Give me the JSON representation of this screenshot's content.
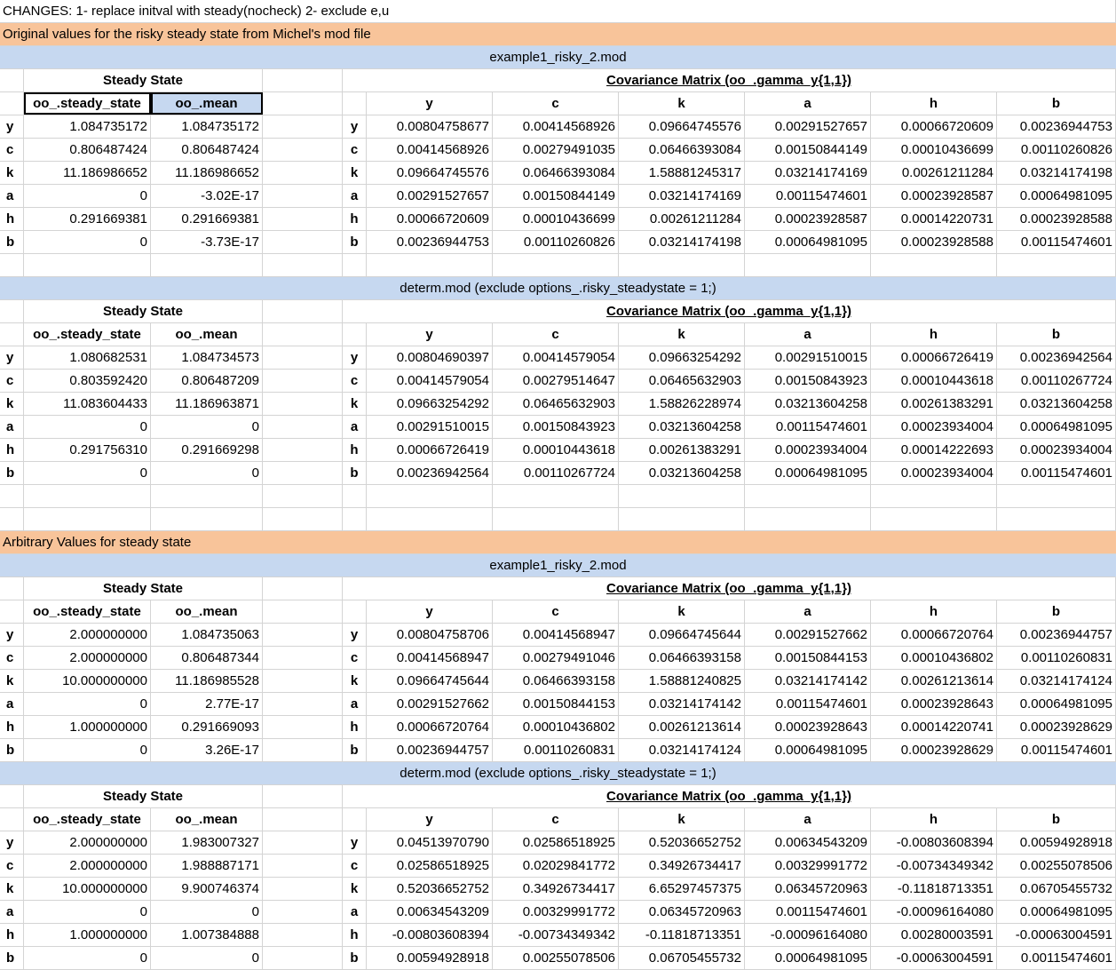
{
  "changes_note": "CHANGES: 1- replace initval with steady(nocheck) 2- exclude e,u",
  "vars": [
    "y",
    "c",
    "k",
    "a",
    "h",
    "b"
  ],
  "labels": {
    "steady_state": "Steady State",
    "cov_title": "Covariance Matrix (oo_.gamma_y{1,1})",
    "col_ss": "oo_.steady_state",
    "col_mean": "oo_.mean"
  },
  "sections": [
    {
      "title": "Original values for the risky steady state from Michel's mod file",
      "blocks": [
        {
          "title": "example1_risky_2.mod",
          "ss": [
            "1.084735172",
            "0.806487424",
            "11.186986652",
            "0",
            "0.291669381",
            "0"
          ],
          "mean": [
            "1.084735172",
            "0.806487424",
            "11.186986652",
            "-3.02E-17",
            "0.291669381",
            "-3.73E-17"
          ],
          "cov": [
            [
              "0.00804758677",
              "0.00414568926",
              "0.09664745576",
              "0.00291527657",
              "0.00066720609",
              "0.00236944753"
            ],
            [
              "0.00414568926",
              "0.00279491035",
              "0.06466393084",
              "0.00150844149",
              "0.00010436699",
              "0.00110260826"
            ],
            [
              "0.09664745576",
              "0.06466393084",
              "1.58881245317",
              "0.03214174169",
              "0.00261211284",
              "0.03214174198"
            ],
            [
              "0.00291527657",
              "0.00150844149",
              "0.03214174169",
              "0.00115474601",
              "0.00023928587",
              "0.00064981095"
            ],
            [
              "0.00066720609",
              "0.00010436699",
              "0.00261211284",
              "0.00023928587",
              "0.00014220731",
              "0.00023928588"
            ],
            [
              "0.00236944753",
              "0.00110260826",
              "0.03214174198",
              "0.00064981095",
              "0.00023928588",
              "0.00115474601"
            ]
          ]
        },
        {
          "title": "determ.mod (exclude options_.risky_steadystate = 1;)",
          "ss": [
            "1.080682531",
            "0.803592420",
            "11.083604433",
            "0",
            "0.291756310",
            "0"
          ],
          "mean": [
            "1.084734573",
            "0.806487209",
            "11.186963871",
            "0",
            "0.291669298",
            "0"
          ],
          "cov": [
            [
              "0.00804690397",
              "0.00414579054",
              "0.09663254292",
              "0.00291510015",
              "0.00066726419",
              "0.00236942564"
            ],
            [
              "0.00414579054",
              "0.00279514647",
              "0.06465632903",
              "0.00150843923",
              "0.00010443618",
              "0.00110267724"
            ],
            [
              "0.09663254292",
              "0.06465632903",
              "1.58826228974",
              "0.03213604258",
              "0.00261383291",
              "0.03213604258"
            ],
            [
              "0.00291510015",
              "0.00150843923",
              "0.03213604258",
              "0.00115474601",
              "0.00023934004",
              "0.00064981095"
            ],
            [
              "0.00066726419",
              "0.00010443618",
              "0.00261383291",
              "0.00023934004",
              "0.00014222693",
              "0.00023934004"
            ],
            [
              "0.00236942564",
              "0.00110267724",
              "0.03213604258",
              "0.00064981095",
              "0.00023934004",
              "0.00115474601"
            ]
          ]
        }
      ]
    },
    {
      "title": "Arbitrary Values for  steady state",
      "blocks": [
        {
          "title": "example1_risky_2.mod",
          "ss": [
            "2.000000000",
            "2.000000000",
            "10.000000000",
            "0",
            "1.000000000",
            "0"
          ],
          "mean": [
            "1.084735063",
            "0.806487344",
            "11.186985528",
            "2.77E-17",
            "0.291669093",
            "3.26E-17"
          ],
          "cov": [
            [
              "0.00804758706",
              "0.00414568947",
              "0.09664745644",
              "0.00291527662",
              "0.00066720764",
              "0.00236944757"
            ],
            [
              "0.00414568947",
              "0.00279491046",
              "0.06466393158",
              "0.00150844153",
              "0.00010436802",
              "0.00110260831"
            ],
            [
              "0.09664745644",
              "0.06466393158",
              "1.58881240825",
              "0.03214174142",
              "0.00261213614",
              "0.03214174124"
            ],
            [
              "0.00291527662",
              "0.00150844153",
              "0.03214174142",
              "0.00115474601",
              "0.00023928643",
              "0.00064981095"
            ],
            [
              "0.00066720764",
              "0.00010436802",
              "0.00261213614",
              "0.00023928643",
              "0.00014220741",
              "0.00023928629"
            ],
            [
              "0.00236944757",
              "0.00110260831",
              "0.03214174124",
              "0.00064981095",
              "0.00023928629",
              "0.00115474601"
            ]
          ]
        },
        {
          "title": "determ.mod (exclude options_.risky_steadystate = 1;)",
          "ss": [
            "2.000000000",
            "2.000000000",
            "10.000000000",
            "0",
            "1.000000000",
            "0"
          ],
          "mean": [
            "1.983007327",
            "1.988887171",
            "9.900746374",
            "0",
            "1.007384888",
            "0"
          ],
          "cov": [
            [
              "0.04513970790",
              "0.02586518925",
              "0.52036652752",
              "0.00634543209",
              "-0.00803608394",
              "0.00594928918"
            ],
            [
              "0.02586518925",
              "0.02029841772",
              "0.34926734417",
              "0.00329991772",
              "-0.00734349342",
              "0.00255078506"
            ],
            [
              "0.52036652752",
              "0.34926734417",
              "6.65297457375",
              "0.06345720963",
              "-0.11818713351",
              "0.06705455732"
            ],
            [
              "0.00634543209",
              "0.00329991772",
              "0.06345720963",
              "0.00115474601",
              "-0.00096164080",
              "0.00064981095"
            ],
            [
              "-0.00803608394",
              "-0.00734349342",
              "-0.11818713351",
              "-0.00096164080",
              "0.00280003591",
              "-0.00063004591"
            ],
            [
              "0.00594928918",
              "0.00255078506",
              "0.06705455732",
              "0.00064981095",
              "-0.00063004591",
              "0.00115474601"
            ]
          ]
        }
      ]
    }
  ]
}
